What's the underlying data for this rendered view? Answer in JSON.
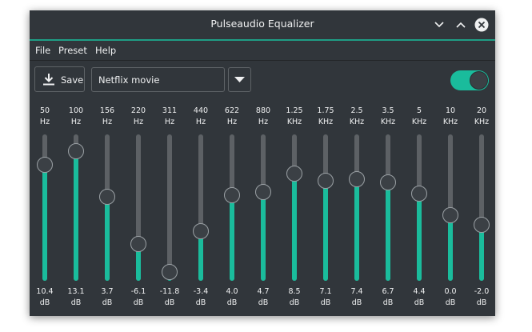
{
  "window": {
    "title": "Pulseaudio Equalizer",
    "accent_color": "#1abc9c",
    "controls": [
      "chevron-down-icon",
      "chevron-up-icon",
      "close-icon"
    ]
  },
  "menu": {
    "file": "File",
    "preset": "Preset",
    "help": "Help"
  },
  "toolbar": {
    "save_label": "Save",
    "save_icon": "download-icon",
    "preset_value": "Netflix movie",
    "dropdown_icon": "triangle-down-icon",
    "enabled": true
  },
  "range_db": [
    -12,
    15
  ],
  "bands": [
    {
      "freq": "50",
      "unit": "Hz",
      "gain": "10.4",
      "gain_unit": "dB"
    },
    {
      "freq": "100",
      "unit": "Hz",
      "gain": "13.1",
      "gain_unit": "dB"
    },
    {
      "freq": "156",
      "unit": "Hz",
      "gain": "3.7",
      "gain_unit": "dB"
    },
    {
      "freq": "220",
      "unit": "Hz",
      "gain": "-6.1",
      "gain_unit": "dB"
    },
    {
      "freq": "311",
      "unit": "Hz",
      "gain": "-11.8",
      "gain_unit": "dB"
    },
    {
      "freq": "440",
      "unit": "Hz",
      "gain": "-3.4",
      "gain_unit": "dB"
    },
    {
      "freq": "622",
      "unit": "Hz",
      "gain": "4.0",
      "gain_unit": "dB"
    },
    {
      "freq": "880",
      "unit": "Hz",
      "gain": "4.7",
      "gain_unit": "dB"
    },
    {
      "freq": "1.25",
      "unit": "KHz",
      "gain": "8.5",
      "gain_unit": "dB"
    },
    {
      "freq": "1.75",
      "unit": "KHz",
      "gain": "7.1",
      "gain_unit": "dB"
    },
    {
      "freq": "2.5",
      "unit": "KHz",
      "gain": "7.4",
      "gain_unit": "dB"
    },
    {
      "freq": "3.5",
      "unit": "KHz",
      "gain": "6.7",
      "gain_unit": "dB"
    },
    {
      "freq": "5",
      "unit": "KHz",
      "gain": "4.4",
      "gain_unit": "dB"
    },
    {
      "freq": "10",
      "unit": "KHz",
      "gain": "0.0",
      "gain_unit": "dB"
    },
    {
      "freq": "20",
      "unit": "KHz",
      "gain": "-2.0",
      "gain_unit": "dB"
    }
  ]
}
